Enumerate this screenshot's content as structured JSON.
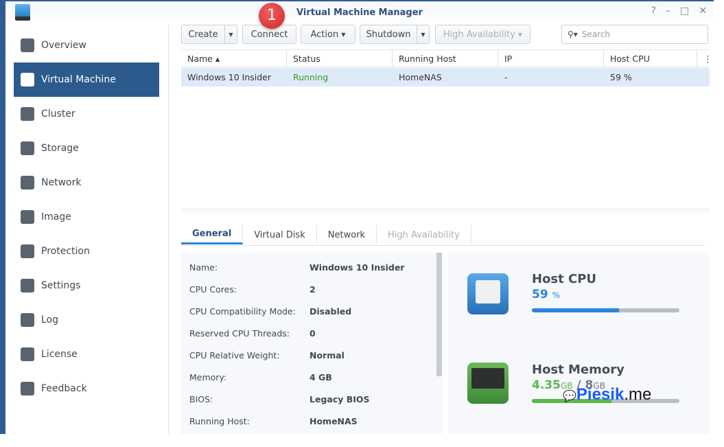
{
  "window": {
    "title": "Virtual Machine Manager",
    "controls": [
      "?",
      "–",
      "□",
      "✕"
    ]
  },
  "badge": "1",
  "sidebar": {
    "items": [
      {
        "label": "Overview"
      },
      {
        "label": "Virtual Machine",
        "active": true
      },
      {
        "label": "Cluster"
      },
      {
        "label": "Storage"
      },
      {
        "label": "Network"
      },
      {
        "label": "Image"
      },
      {
        "label": "Protection"
      },
      {
        "label": "Settings"
      },
      {
        "label": "Log"
      },
      {
        "label": "License"
      },
      {
        "label": "Feedback"
      }
    ]
  },
  "toolbar": {
    "create": "Create",
    "connect": "Connect",
    "action": "Action",
    "shutdown": "Shutdown",
    "ha": "High Availability",
    "search_placeholder": "Search"
  },
  "table": {
    "headers": [
      "Name ▴",
      "Status",
      "Running Host",
      "IP",
      "Host CPU"
    ],
    "rows": [
      {
        "name": "Windows 10 Insider",
        "status": "Running",
        "host": "HomeNAS",
        "ip": "-",
        "cpu": "59 %"
      }
    ]
  },
  "tabs": [
    "General",
    "Virtual Disk",
    "Network",
    "High Availability"
  ],
  "details": [
    {
      "label": "Name:",
      "value": "Windows 10 Insider"
    },
    {
      "label": "CPU Cores:",
      "value": "2"
    },
    {
      "label": "CPU Compatibility Mode:",
      "value": "Disabled"
    },
    {
      "label": "Reserved CPU Threads:",
      "value": "0"
    },
    {
      "label": "CPU Relative Weight:",
      "value": "Normal"
    },
    {
      "label": "Memory:",
      "value": "4 GB"
    },
    {
      "label": "BIOS:",
      "value": "Legacy BIOS"
    },
    {
      "label": "Running Host:",
      "value": "HomeNAS"
    }
  ],
  "stats": {
    "cpu": {
      "title": "Host CPU",
      "value": "59",
      "unit": "%",
      "percent": 59
    },
    "memory": {
      "title": "Host Memory",
      "used": "4.35",
      "used_unit": "GB",
      "sep": "/",
      "total": "8",
      "total_unit": "GB",
      "percent": 54
    }
  },
  "watermark": {
    "brand": "Piesik",
    "suffix": ".me"
  },
  "colors": {
    "accent": "#2c5a8c",
    "running": "#3a9a1a",
    "cpu_bar": "#2a86d8",
    "mem_bar": "#5cb84c"
  }
}
